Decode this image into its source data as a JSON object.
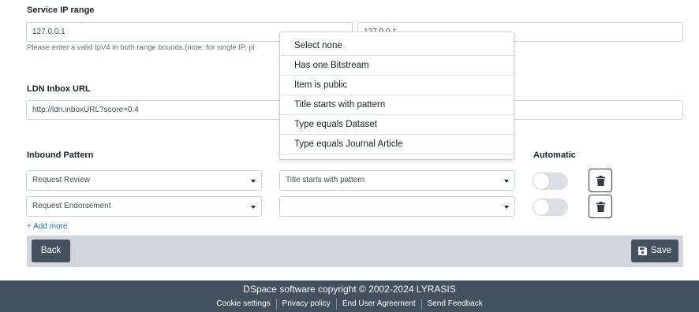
{
  "service_ip": {
    "label": "Service IP range",
    "lower_value": "127.0.0.1",
    "upper_value": "127.0.0.1",
    "hint": "Please enter a valid IpV4 in both range bounds (note: for single IP, pl"
  },
  "ldn": {
    "label": "LDN Inbox URL",
    "value": "http://ldn.inboxURL?score=0.4"
  },
  "inbound": {
    "pattern_header": "Inbound Pattern",
    "automatic_header": "Automatic",
    "rows": [
      {
        "pattern": "Request Review",
        "constraint": "Title starts with pattern",
        "automatic": false
      },
      {
        "pattern": "Request Endorsement",
        "constraint": "",
        "automatic": false
      }
    ],
    "add_more": "+ Add more"
  },
  "constraint_menu": {
    "options": [
      "Select none",
      "Has one Bitstream",
      "Item is public",
      "Title starts with pattern",
      "Type equals Dataset",
      "Type equals Journal Article"
    ]
  },
  "actions": {
    "back_label": "Back",
    "save_label": "Save"
  },
  "footer": {
    "copyright": "DSpace software copyright © 2002-2024 LYRASIS",
    "links": [
      "Cookie settings",
      "Privacy policy",
      "End User Agreement",
      "Send Feedback"
    ]
  },
  "colors": {
    "dark_button": "#43515f",
    "toolbar_bg": "#d2d6dc",
    "link": "#1f6fb5",
    "toggle_off": "#dcdfe3"
  }
}
